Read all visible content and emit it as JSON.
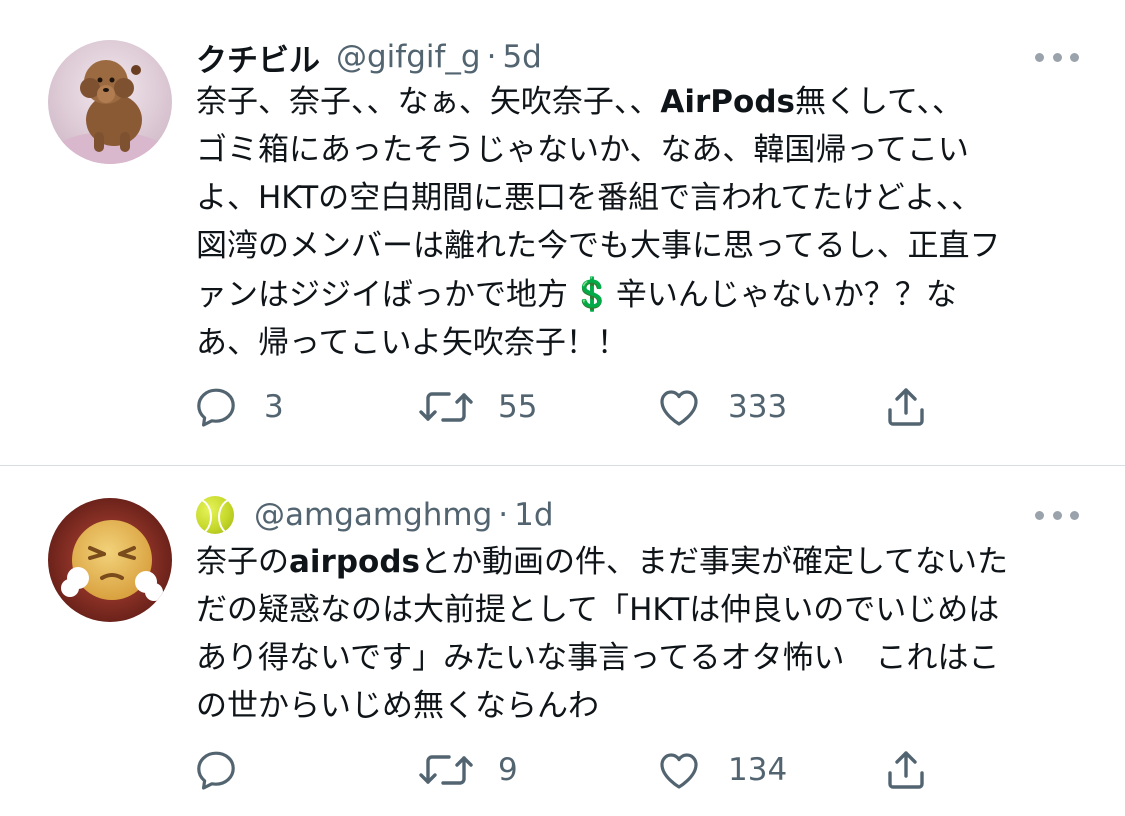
{
  "tweets": [
    {
      "name": "クチビル",
      "handle": "@gifgif_g",
      "separator": "·",
      "time": "5d",
      "text_lines": [
        {
          "before": "奈子、奈子、、なぁ、矢吹奈子、、",
          "bold": "AirPods",
          "after": "無くして、、"
        },
        {
          "text": "ゴミ箱にあったそうじゃないか、なあ、韓国帰ってこい"
        },
        {
          "text": "よ、HKTの空白期間に悪口を番組で言われてたけどよ、、"
        },
        {
          "text": "図湾のメンバーは離れた今でも大事に思ってるし、正直フ"
        },
        {
          "before": "ァンはジジイばっかで地方",
          "emoji": "💲",
          "after": "辛いんじゃないか？？な"
        },
        {
          "text": "あ、帰ってこいよ矢吹奈子！！"
        }
      ],
      "replies": "3",
      "retweets": "55",
      "likes": "333",
      "avatar": "toy-poodle-plush-avatar",
      "more_icon": "more-dots-icon"
    },
    {
      "name_emoji": "tennis-ball-icon",
      "handle": "@amgamghmg",
      "separator": "·",
      "time": "1d",
      "text_lines": [
        {
          "before": "奈子の",
          "bold": "airpods",
          "after": "とか動画の件、まだ事実が確定してないた"
        },
        {
          "text": "だの疑惑なのは大前提として「HKTは仲良いのでいじめは"
        },
        {
          "text": "あり得ないです」みたいな事言ってるオタ怖い　これはこ"
        },
        {
          "text": "の世からいじめ無くならんわ"
        }
      ],
      "replies": "",
      "retweets": "9",
      "likes": "134",
      "avatar": "angry-face-avatar",
      "more_icon": "more-dots-icon"
    }
  ],
  "colors": {
    "text": "#0f1419",
    "secondary": "#536471",
    "divider": "#d8dde1",
    "icon": "#536471"
  }
}
